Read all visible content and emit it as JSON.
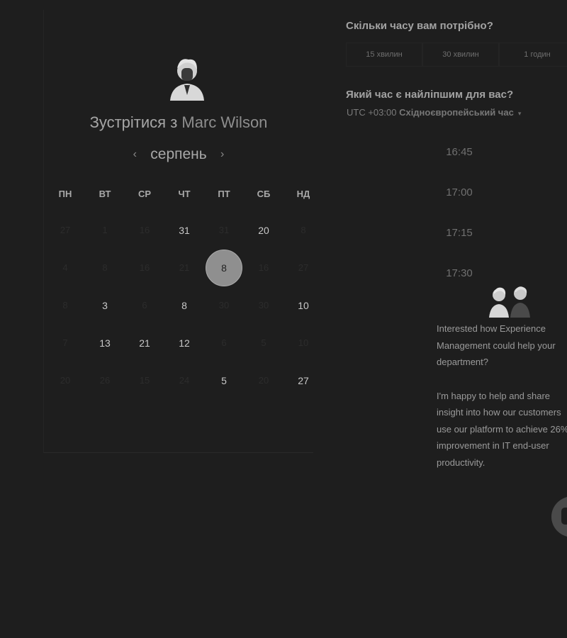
{
  "meeting": {
    "title_prefix": "Зустрітися з",
    "host_name": "Marc Wilson"
  },
  "calendar": {
    "month": "серпень",
    "prev_arrow": "‹",
    "next_arrow": "›",
    "weekdays": [
      "ПН",
      "ВТ",
      "СР",
      "ЧТ",
      "ПТ",
      "СБ",
      "НД"
    ],
    "days": [
      {
        "label": "27",
        "available": false
      },
      {
        "label": "1",
        "available": false
      },
      {
        "label": "16",
        "available": false
      },
      {
        "label": "31",
        "available": true
      },
      {
        "label": "31",
        "available": false
      },
      {
        "label": "20",
        "available": true
      },
      {
        "label": "8",
        "available": false
      },
      {
        "label": "4",
        "available": false
      },
      {
        "label": "8",
        "available": false
      },
      {
        "label": "16",
        "available": false
      },
      {
        "label": "21",
        "available": false
      },
      {
        "label": "8",
        "available": true,
        "selected": true
      },
      {
        "label": "16",
        "available": false
      },
      {
        "label": "27",
        "available": false
      },
      {
        "label": "8",
        "available": false
      },
      {
        "label": "3",
        "available": true
      },
      {
        "label": "6",
        "available": false
      },
      {
        "label": "8",
        "available": true
      },
      {
        "label": "30",
        "available": false
      },
      {
        "label": "30",
        "available": false
      },
      {
        "label": "10",
        "available": true
      },
      {
        "label": "7",
        "available": false
      },
      {
        "label": "13",
        "available": true
      },
      {
        "label": "21",
        "available": true
      },
      {
        "label": "12",
        "available": true
      },
      {
        "label": "6",
        "available": false
      },
      {
        "label": "5",
        "available": false
      },
      {
        "label": "10",
        "available": false
      },
      {
        "label": "20",
        "available": false
      },
      {
        "label": "26",
        "available": false
      },
      {
        "label": "15",
        "available": false
      },
      {
        "label": "24",
        "available": false
      },
      {
        "label": "5",
        "available": true
      },
      {
        "label": "20",
        "available": false
      },
      {
        "label": "27",
        "available": true
      }
    ]
  },
  "duration": {
    "title": "Скільки часу вам потрібно?",
    "options": [
      "15 хвилин",
      "30 хвилин",
      "1 годин"
    ]
  },
  "time": {
    "title": "Який час є найліпшим для вас?",
    "tz_offset": "UTC +03:00",
    "tz_name": "Східноєвропейський час",
    "caret": "▾",
    "slots": [
      "16:45",
      "17:00",
      "17:15",
      "17:30"
    ]
  },
  "info": {
    "paragraph1": "Interested how Experience Management could help your department?",
    "paragraph2": "I'm happy to help and share insight into how our customers use our platform to achieve 26% improvement in IT end-user productivity."
  }
}
